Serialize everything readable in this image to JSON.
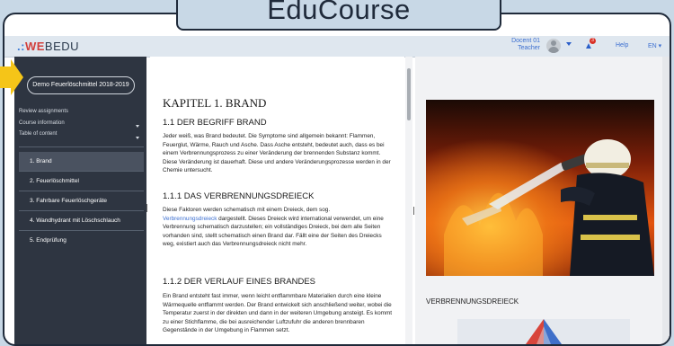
{
  "banner": {
    "title": "EduCourse"
  },
  "topbar": {
    "logo_dots": ".:",
    "logo_we": "WE",
    "logo_rest": "BEDU",
    "user_name": "Docent 01",
    "user_role": "Teacher",
    "notification_count": "3",
    "help": "Help",
    "language": "EN"
  },
  "sidebar": {
    "course_button": "Demo Feuerlöschmittel 2018-2019",
    "links": [
      "Review assignments",
      "Course information",
      "Table of content"
    ],
    "nav": [
      "1. Brand",
      "2. Feuerlöschmittel",
      "3. Fahrbare Feuerlöschgeräte",
      "4. Wandhydrant mit Löschschlauch",
      "5. Endprüfung"
    ],
    "active_index": 0
  },
  "content": {
    "chapter_title": "KAPITEL 1. BRAND",
    "s1_title": "1.1 DER BEGRIFF BRAND",
    "s1_text": "Jeder weiß, was Brand bedeutet. Die Symptome sind allgemein bekannt: Flammen, Feuerglut, Wärme, Rauch und Asche. Dass Asche entsteht, bedeutet auch, dass es bei einem Verbrennungsprozess zu einer Veränderung der brennenden Substanz kommt. Diese Veränderung ist dauerhaft. Diese und andere Veränderungsprozesse werden in der Chemie untersucht.",
    "s2_title": "1.1.1 DAS VERBRENNUNGSDREIECK",
    "s2_text_before": "Diese Faktoren werden schematisch mit einem Dreieck, dem sog.",
    "s2_link": "Verbrennungsdreieck",
    "s2_text_after": " dargestellt. Dieses Dreieck wird international verwendet, um eine Verbrennung schematisch darzustellen; ein vollständiges Dreieck, bei dem alle Seiten vorhanden sind, stellt schematisch einen Brand dar. Fällt eine der Seiten des Dreiecks weg, existiert auch das Verbrennungsdreieck nicht mehr.",
    "s3_title": "1.1.2 DER VERLAUF EINES BRANDES",
    "s3_text": "Ein Brand entsteht fast immer, wenn leicht entflammbare Materialien durch eine kleine Wärmequelle entflammt werden. Der Brand entwickelt sich anschließend weiter, wobei die Temperatur zuerst in der direkten und dann in der weiteren Umgebung ansteigt. Es kommt zu einer Stichflamme, die bei ausreichender Luftzufuhr die anderen brennbaren Gegenstände in der Umgebung in Flammen setzt."
  },
  "right": {
    "section_label": "VERBRENNUNGSDREIECK"
  },
  "colors": {
    "sidebar": "#2e3541",
    "accent_blue": "#3c6fd0",
    "brand_red": "#d2403c",
    "arrow": "#f5c518"
  }
}
